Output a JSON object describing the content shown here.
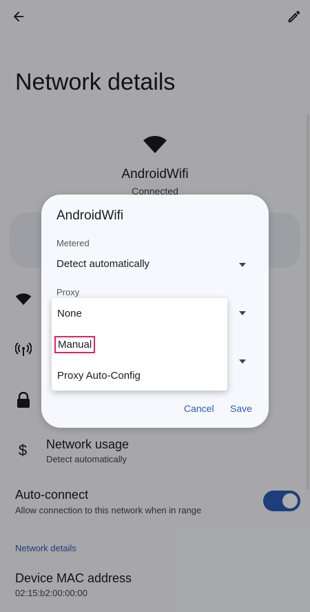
{
  "background": {
    "page_title": "Network details",
    "network_name": "AndroidWifi",
    "network_status": "Connected",
    "network_usage_title": "Network usage",
    "network_usage_sub": "Detect automatically",
    "auto_connect_title": "Auto-connect",
    "auto_connect_sub": "Allow connection to this network when in range",
    "auto_connect_on": true,
    "section_header": "Network details",
    "mac_title": "Device MAC address",
    "mac_value": "02:15:b2:00:00:00"
  },
  "dialog": {
    "title": "AndroidWifi",
    "metered_label": "Metered",
    "metered_value": "Detect automatically",
    "proxy_label": "Proxy",
    "cancel_label": "Cancel",
    "save_label": "Save"
  },
  "proxy_menu": {
    "options": [
      "None",
      "Manual",
      "Proxy Auto-Config"
    ],
    "highlighted": "Manual"
  },
  "colors": {
    "accent": "#2b5cb7",
    "highlight_box": "#e0245e"
  },
  "icons": [
    "back-arrow-icon",
    "edit-pencil-icon",
    "wifi-icon",
    "hotspot-antenna-icon",
    "lock-icon",
    "dollar-icon"
  ]
}
